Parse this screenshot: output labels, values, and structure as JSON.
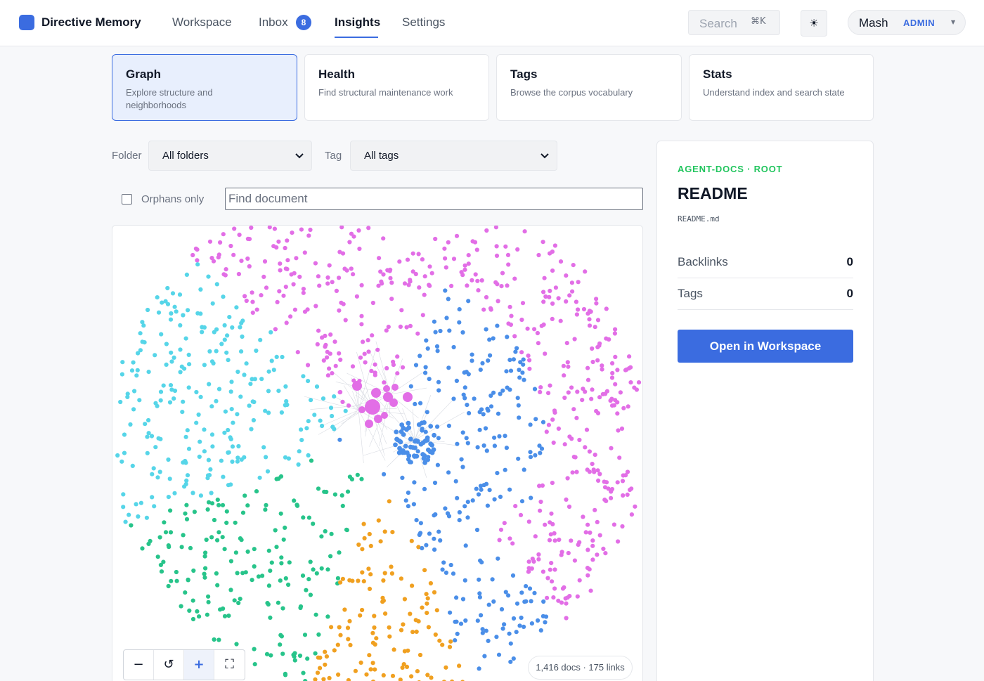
{
  "app": {
    "name": "Directive Memory"
  },
  "nav": {
    "items": [
      {
        "label": "Workspace"
      },
      {
        "label": "Inbox",
        "badge": "8"
      },
      {
        "label": "Insights",
        "active": true
      },
      {
        "label": "Settings"
      }
    ]
  },
  "search": {
    "label": "Search",
    "shortcut": "⌘K"
  },
  "theme": {
    "icon": "sun-icon",
    "glyph": "☀"
  },
  "user": {
    "name": "Mash",
    "role": "ADMIN"
  },
  "cards": [
    {
      "title": "Graph",
      "desc": "Explore structure and neighborhoods",
      "active": true
    },
    {
      "title": "Health",
      "desc": "Find structural maintenance work"
    },
    {
      "title": "Tags",
      "desc": "Browse the corpus vocabulary"
    },
    {
      "title": "Stats",
      "desc": "Understand index and search state"
    }
  ],
  "filters": {
    "folder_label": "Folder",
    "folder_value": "All folders",
    "tag_label": "Tag",
    "tag_value": "All tags",
    "orphans_label": "Orphans only",
    "orphans_checked": false,
    "find_placeholder": "Find document"
  },
  "graph": {
    "colors": {
      "magenta": "#e26ee6",
      "blue": "#4a8ee8",
      "cyan": "#56d5e8",
      "green": "#27c48a",
      "orange": "#f0a020"
    },
    "zoom_controls": {
      "out": "−",
      "reset": "↺",
      "in": "+",
      "fit": "⛶"
    },
    "stats": "1,416 docs · 175 links"
  },
  "detail": {
    "eyebrow": "AGENT-DOCS · ROOT",
    "title": "README",
    "path": "README.md",
    "backlinks_label": "Backlinks",
    "backlinks_value": "0",
    "tags_label": "Tags",
    "tags_value": "0",
    "open_button": "Open in Workspace"
  }
}
